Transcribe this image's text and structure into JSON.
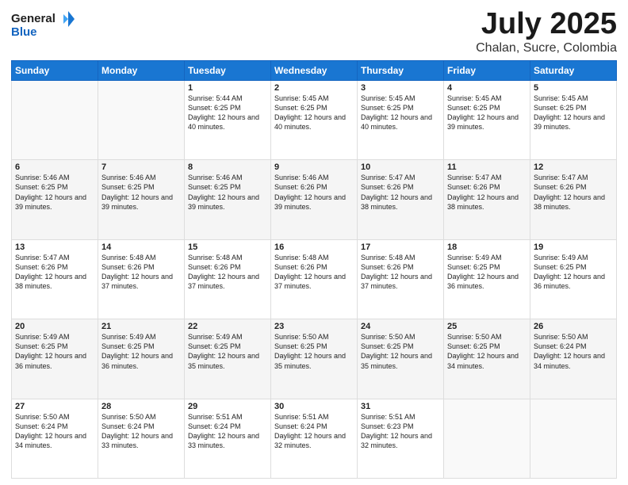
{
  "header": {
    "logo_general": "General",
    "logo_blue": "Blue",
    "title": "July 2025",
    "subtitle": "Chalan, Sucre, Colombia"
  },
  "weekdays": [
    "Sunday",
    "Monday",
    "Tuesday",
    "Wednesday",
    "Thursday",
    "Friday",
    "Saturday"
  ],
  "weeks": [
    [
      {
        "day": "",
        "info": ""
      },
      {
        "day": "",
        "info": ""
      },
      {
        "day": "1",
        "info": "Sunrise: 5:44 AM\nSunset: 6:25 PM\nDaylight: 12 hours and 40 minutes."
      },
      {
        "day": "2",
        "info": "Sunrise: 5:45 AM\nSunset: 6:25 PM\nDaylight: 12 hours and 40 minutes."
      },
      {
        "day": "3",
        "info": "Sunrise: 5:45 AM\nSunset: 6:25 PM\nDaylight: 12 hours and 40 minutes."
      },
      {
        "day": "4",
        "info": "Sunrise: 5:45 AM\nSunset: 6:25 PM\nDaylight: 12 hours and 39 minutes."
      },
      {
        "day": "5",
        "info": "Sunrise: 5:45 AM\nSunset: 6:25 PM\nDaylight: 12 hours and 39 minutes."
      }
    ],
    [
      {
        "day": "6",
        "info": "Sunrise: 5:46 AM\nSunset: 6:25 PM\nDaylight: 12 hours and 39 minutes."
      },
      {
        "day": "7",
        "info": "Sunrise: 5:46 AM\nSunset: 6:25 PM\nDaylight: 12 hours and 39 minutes."
      },
      {
        "day": "8",
        "info": "Sunrise: 5:46 AM\nSunset: 6:25 PM\nDaylight: 12 hours and 39 minutes."
      },
      {
        "day": "9",
        "info": "Sunrise: 5:46 AM\nSunset: 6:26 PM\nDaylight: 12 hours and 39 minutes."
      },
      {
        "day": "10",
        "info": "Sunrise: 5:47 AM\nSunset: 6:26 PM\nDaylight: 12 hours and 38 minutes."
      },
      {
        "day": "11",
        "info": "Sunrise: 5:47 AM\nSunset: 6:26 PM\nDaylight: 12 hours and 38 minutes."
      },
      {
        "day": "12",
        "info": "Sunrise: 5:47 AM\nSunset: 6:26 PM\nDaylight: 12 hours and 38 minutes."
      }
    ],
    [
      {
        "day": "13",
        "info": "Sunrise: 5:47 AM\nSunset: 6:26 PM\nDaylight: 12 hours and 38 minutes."
      },
      {
        "day": "14",
        "info": "Sunrise: 5:48 AM\nSunset: 6:26 PM\nDaylight: 12 hours and 37 minutes."
      },
      {
        "day": "15",
        "info": "Sunrise: 5:48 AM\nSunset: 6:26 PM\nDaylight: 12 hours and 37 minutes."
      },
      {
        "day": "16",
        "info": "Sunrise: 5:48 AM\nSunset: 6:26 PM\nDaylight: 12 hours and 37 minutes."
      },
      {
        "day": "17",
        "info": "Sunrise: 5:48 AM\nSunset: 6:26 PM\nDaylight: 12 hours and 37 minutes."
      },
      {
        "day": "18",
        "info": "Sunrise: 5:49 AM\nSunset: 6:25 PM\nDaylight: 12 hours and 36 minutes."
      },
      {
        "day": "19",
        "info": "Sunrise: 5:49 AM\nSunset: 6:25 PM\nDaylight: 12 hours and 36 minutes."
      }
    ],
    [
      {
        "day": "20",
        "info": "Sunrise: 5:49 AM\nSunset: 6:25 PM\nDaylight: 12 hours and 36 minutes."
      },
      {
        "day": "21",
        "info": "Sunrise: 5:49 AM\nSunset: 6:25 PM\nDaylight: 12 hours and 36 minutes."
      },
      {
        "day": "22",
        "info": "Sunrise: 5:49 AM\nSunset: 6:25 PM\nDaylight: 12 hours and 35 minutes."
      },
      {
        "day": "23",
        "info": "Sunrise: 5:50 AM\nSunset: 6:25 PM\nDaylight: 12 hours and 35 minutes."
      },
      {
        "day": "24",
        "info": "Sunrise: 5:50 AM\nSunset: 6:25 PM\nDaylight: 12 hours and 35 minutes."
      },
      {
        "day": "25",
        "info": "Sunrise: 5:50 AM\nSunset: 6:25 PM\nDaylight: 12 hours and 34 minutes."
      },
      {
        "day": "26",
        "info": "Sunrise: 5:50 AM\nSunset: 6:24 PM\nDaylight: 12 hours and 34 minutes."
      }
    ],
    [
      {
        "day": "27",
        "info": "Sunrise: 5:50 AM\nSunset: 6:24 PM\nDaylight: 12 hours and 34 minutes."
      },
      {
        "day": "28",
        "info": "Sunrise: 5:50 AM\nSunset: 6:24 PM\nDaylight: 12 hours and 33 minutes."
      },
      {
        "day": "29",
        "info": "Sunrise: 5:51 AM\nSunset: 6:24 PM\nDaylight: 12 hours and 33 minutes."
      },
      {
        "day": "30",
        "info": "Sunrise: 5:51 AM\nSunset: 6:24 PM\nDaylight: 12 hours and 32 minutes."
      },
      {
        "day": "31",
        "info": "Sunrise: 5:51 AM\nSunset: 6:23 PM\nDaylight: 12 hours and 32 minutes."
      },
      {
        "day": "",
        "info": ""
      },
      {
        "day": "",
        "info": ""
      }
    ]
  ]
}
